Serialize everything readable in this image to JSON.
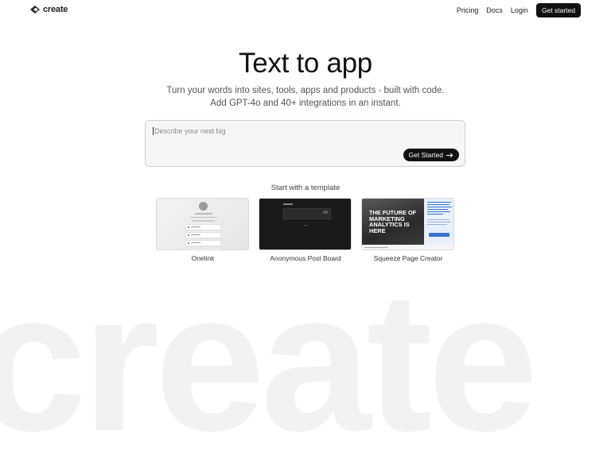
{
  "header": {
    "logo_text": "create",
    "nav": [
      "Pricing",
      "Docs",
      "Login"
    ],
    "cta": "Get started"
  },
  "hero": {
    "title": "Text to app",
    "subtitle_line1": "Turn your words into sites, tools, apps and products - built with code.",
    "subtitle_line2": "Add GPT-4o and 40+ integrations in an instant."
  },
  "prompt": {
    "placeholder": "Describe your next big",
    "button": "Get Started"
  },
  "templates": {
    "heading": "Start with a template",
    "items": [
      {
        "label": "Onelink"
      },
      {
        "label": "Anonymous Post Board"
      },
      {
        "label": "Squeeze Page Creator",
        "headline": "The future of marketing analytics is here"
      }
    ]
  },
  "watermark": "create",
  "colors": {
    "primary": "#111111",
    "muted_text": "#555555",
    "accent_blue": "#3b76d0"
  }
}
